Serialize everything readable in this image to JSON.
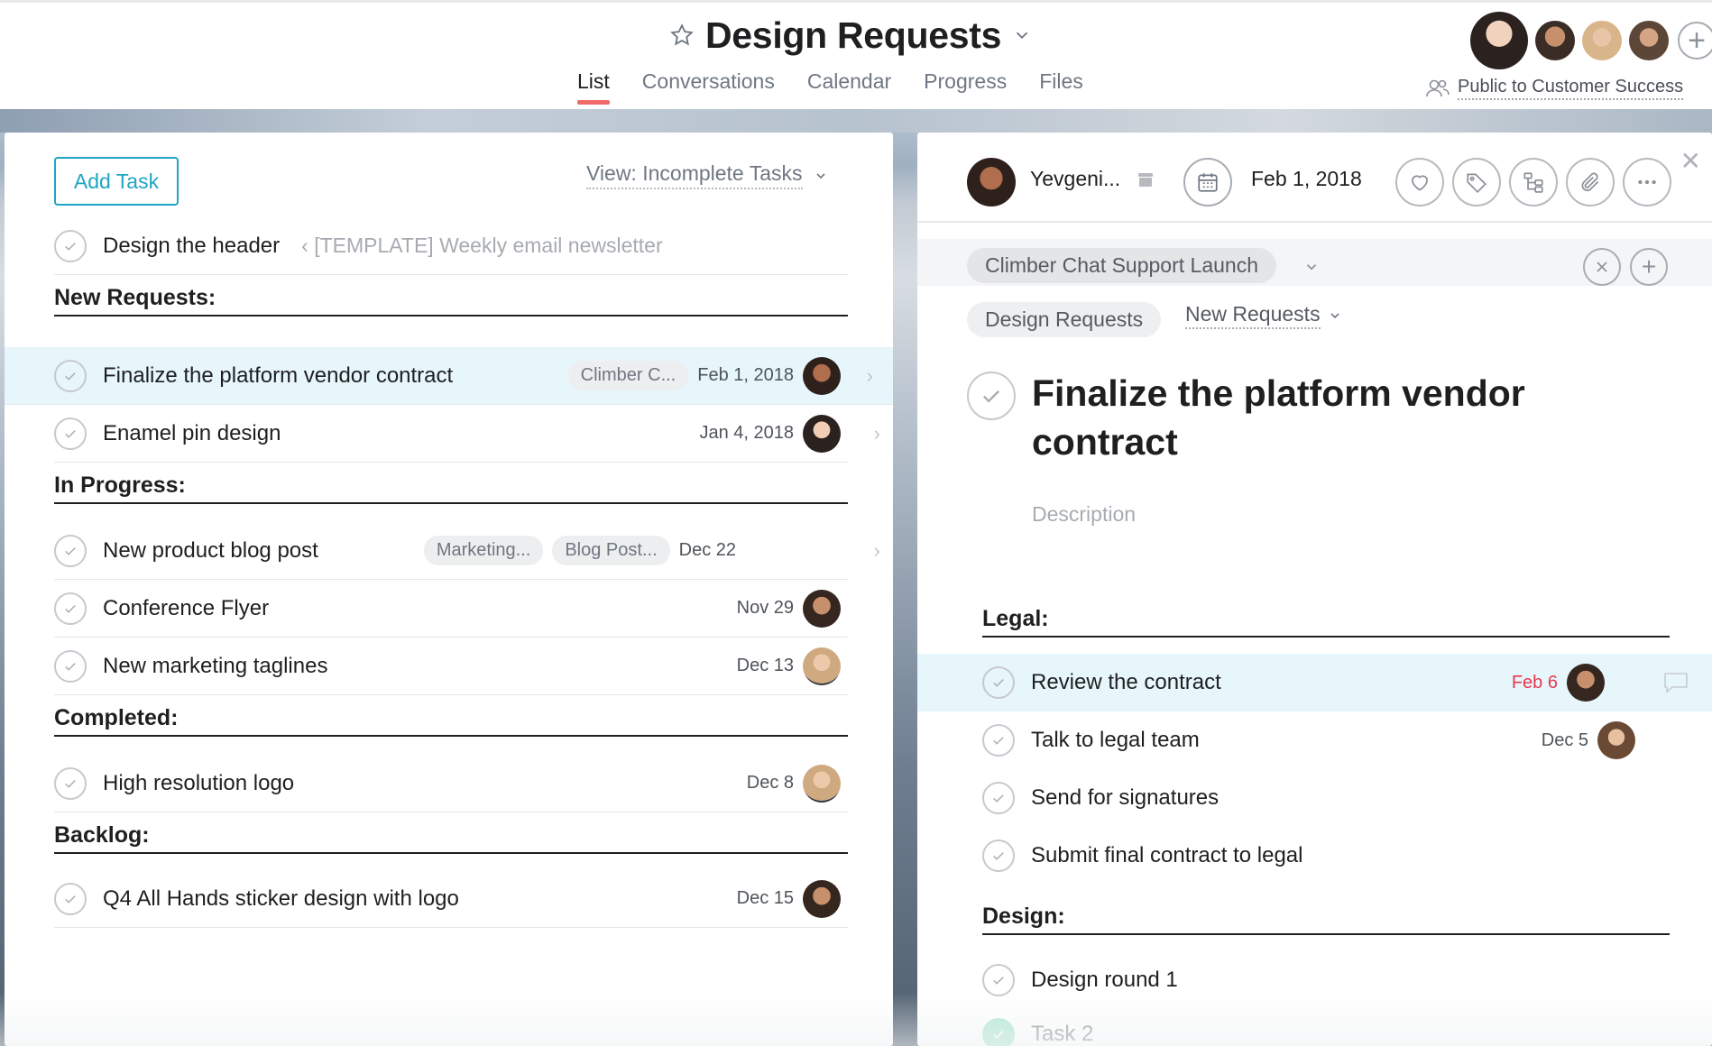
{
  "header": {
    "title": "Design Requests",
    "tabs": [
      {
        "label": "List",
        "active": true
      },
      {
        "label": "Conversations",
        "active": false
      },
      {
        "label": "Calendar",
        "active": false
      },
      {
        "label": "Progress",
        "active": false
      },
      {
        "label": "Files",
        "active": false
      }
    ],
    "privacy_label": "Public to Customer Success",
    "member_avatar_colors": [
      "#c98f6d",
      "#b07a5a",
      "#d8b08c",
      "#8b6a58"
    ]
  },
  "list": {
    "add_task_label": "Add Task",
    "view_label": "View: Incomplete Tasks",
    "top_task": {
      "name": "Design the header",
      "breadcrumb": "[TEMPLATE] Weekly email newsletter"
    },
    "sections": [
      {
        "title": "New Requests:",
        "tasks": [
          {
            "name": "Finalize the platform vendor contract",
            "tags": [
              "Climber C..."
            ],
            "due": "Feb 1, 2018",
            "avatar_color": "#7a4a34",
            "selected": true
          },
          {
            "name": "Enamel pin design",
            "tags": [],
            "due": "Jan 4, 2018",
            "avatar_color": "#3b2e2a"
          }
        ]
      },
      {
        "title": "In Progress:",
        "tasks": [
          {
            "name": "New product blog post",
            "tags": [
              "Marketing...",
              "Blog Post..."
            ],
            "due": "Dec 22",
            "avatar_color": null
          },
          {
            "name": "Conference Flyer",
            "tags": [],
            "due": "Nov 29",
            "avatar_color": "#5a3c2c"
          },
          {
            "name": "New marketing taglines",
            "tags": [],
            "due": "Dec 13",
            "avatar_color": "#c9a27c"
          }
        ]
      },
      {
        "title": "Completed:",
        "tasks": [
          {
            "name": "High resolution logo",
            "tags": [],
            "due": "Dec 8",
            "avatar_color": "#c9a27c"
          }
        ]
      },
      {
        "title": "Backlog:",
        "tasks": [
          {
            "name": "Q4 All Hands sticker design with logo",
            "tags": [],
            "due": "Dec 15",
            "avatar_color": "#5a3c2c"
          }
        ]
      }
    ]
  },
  "detail": {
    "assignee": "Yevgeni...",
    "due_date": "Feb 1, 2018",
    "project_pill": "Climber Chat Support Launch",
    "project2_pill": "Design Requests",
    "section_select": "New Requests",
    "title": "Finalize the platform vendor contract",
    "description_placeholder": "Description",
    "subtask_sections": [
      {
        "title": "Legal:",
        "subtasks": [
          {
            "name": "Review the contract",
            "due": "Feb 6",
            "due_red": true,
            "avatar_color": "#5a3c2c",
            "selected": true
          },
          {
            "name": "Talk to legal team",
            "due": "Dec 5",
            "due_red": false,
            "avatar_color": "#3aa8c9"
          },
          {
            "name": "Send for signatures",
            "due": "",
            "due_red": false,
            "avatar_color": null
          },
          {
            "name": "Submit final contract to legal",
            "due": "",
            "due_red": false,
            "avatar_color": null
          }
        ]
      },
      {
        "title": "Design:",
        "subtasks": [
          {
            "name": "Design round 1",
            "due": "",
            "due_red": false,
            "avatar_color": null
          },
          {
            "name": "Task 2",
            "due": "",
            "due_red": false,
            "avatar_color": null,
            "done": true
          }
        ]
      }
    ]
  }
}
